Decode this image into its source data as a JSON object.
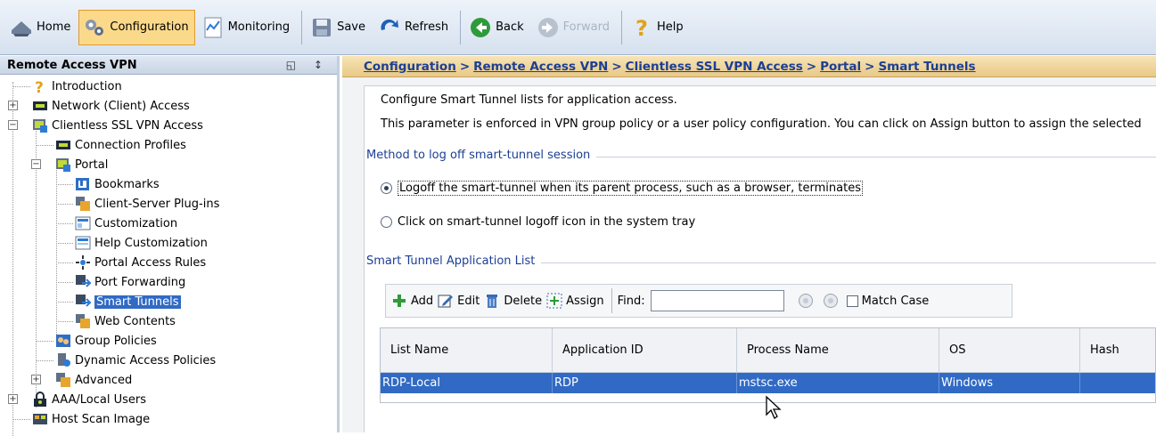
{
  "toolbar": {
    "home": "Home",
    "configuration": "Configuration",
    "monitoring": "Monitoring",
    "save": "Save",
    "refresh": "Refresh",
    "back": "Back",
    "forward": "Forward",
    "help": "Help"
  },
  "left_panel": {
    "title": "Remote Access VPN",
    "pin_glyphs": "◱ ↕",
    "tree": {
      "introduction": "Introduction",
      "network_client_access": "Network (Client) Access",
      "clientless_ssl": "Clientless SSL VPN Access",
      "connection_profiles": "Connection Profiles",
      "portal": "Portal",
      "bookmarks": "Bookmarks",
      "client_server_plugins": "Client-Server Plug-ins",
      "customization": "Customization",
      "help_customization": "Help Customization",
      "portal_access_rules": "Portal Access Rules",
      "port_forwarding": "Port Forwarding",
      "smart_tunnels": "Smart Tunnels",
      "web_contents": "Web Contents",
      "group_policies": "Group Policies",
      "dynamic_access_policies": "Dynamic Access Policies",
      "advanced": "Advanced",
      "aaa_local_users": "AAA/Local Users",
      "host_scan_image": "Host Scan Image"
    }
  },
  "breadcrumb": {
    "configuration": "Configuration",
    "remote_access_vpn": "Remote Access VPN",
    "clientless": "Clientless SSL VPN Access",
    "portal": "Portal",
    "smart_tunnels": "Smart Tunnels",
    "separator": ">"
  },
  "main": {
    "intro1": "Configure Smart Tunnel lists for application access.",
    "intro2": "This parameter is enforced in VPN group policy or a user policy configuration. You can click on Assign button to assign the selected",
    "logoff_section_title": "Method to log off smart-tunnel session",
    "radio1": "Logoff the smart-tunnel when its parent process, such as a browser, terminates",
    "radio2": "Click on smart-tunnel logoff icon in the system tray",
    "list_section_title": "Smart Tunnel Application List",
    "actions": {
      "add": "Add",
      "edit": "Edit",
      "delete": "Delete",
      "assign": "Assign",
      "find": "Find:",
      "match_case": "Match Case"
    },
    "find_value": "",
    "table": {
      "headers": [
        "List Name",
        "Application ID",
        "Process Name",
        "OS",
        "Hash"
      ],
      "rows": [
        [
          "RDP-Local",
          "RDP",
          "mstsc.exe",
          "Windows",
          ""
        ]
      ]
    }
  }
}
